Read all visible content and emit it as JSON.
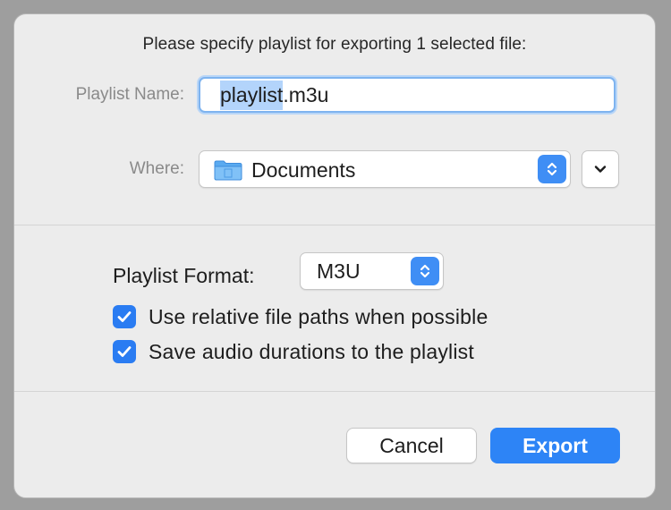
{
  "dialog": {
    "prompt": "Please specify playlist for exporting 1 selected file:",
    "playlist_name_label": "Playlist Name:",
    "playlist_name_selected": "playlist",
    "playlist_name_rest": ".m3u",
    "where_label": "Where:",
    "where_value": "Documents",
    "where_icon": "folder-icon",
    "format_label": "Playlist Format:",
    "format_value": "M3U",
    "checkboxes": [
      {
        "label": "Use relative file paths when possible",
        "checked": true
      },
      {
        "label": "Save audio durations to the playlist",
        "checked": true
      }
    ],
    "cancel_label": "Cancel",
    "export_label": "Export"
  },
  "colors": {
    "accent": "#2d84f6",
    "selection": "#b3d4fb",
    "background": "#ececec"
  }
}
